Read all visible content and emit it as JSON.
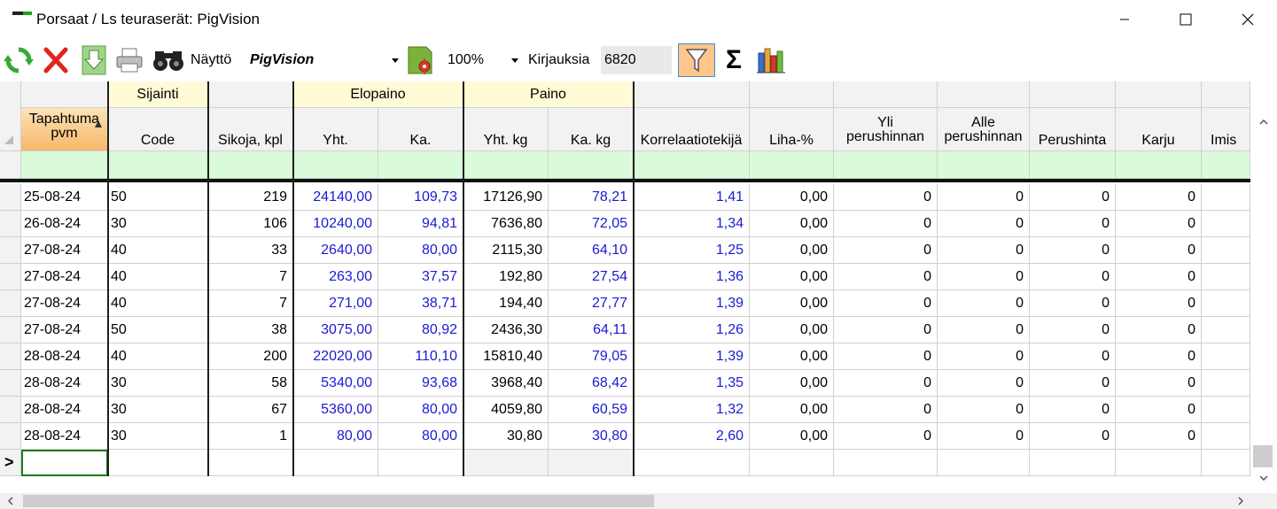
{
  "window": {
    "title": "Porsaat / Ls teuraserät: PigVision"
  },
  "toolbar": {
    "display_label": "Näyttö",
    "display_value": "PigVision",
    "zoom_value": "100%",
    "records_label": "Kirjauksia",
    "records_count": "6820",
    "sum_symbol": "Σ"
  },
  "grid": {
    "groups": {
      "sijainti": "Sijainti",
      "elopaino": "Elopaino",
      "paino": "Paino"
    },
    "columns": {
      "date": [
        "Tapahtuma",
        "pvm"
      ],
      "code": "Code",
      "sikoja": "Sikoja, kpl",
      "elo_yht": "Yht.",
      "elo_ka": "Ka.",
      "paino_yht": "Yht. kg",
      "paino_ka": "Ka. kg",
      "korr": "Korrelaatiotekijä",
      "liha": "Liha-%",
      "yli": [
        "Yli",
        "perushinnan"
      ],
      "alle": [
        "Alle",
        "perushinnan"
      ],
      "perushinta": "Perushinta",
      "karju": "Karju",
      "imis": "Imis"
    },
    "rows": [
      [
        "25-08-24",
        "50",
        "219",
        "24140,00",
        "109,73",
        "17126,90",
        "78,21",
        "1,41",
        "0,00",
        "0",
        "0",
        "0",
        "0"
      ],
      [
        "26-08-24",
        "30",
        "106",
        "10240,00",
        "94,81",
        "7636,80",
        "72,05",
        "1,34",
        "0,00",
        "0",
        "0",
        "0",
        "0"
      ],
      [
        "27-08-24",
        "40",
        "33",
        "2640,00",
        "80,00",
        "2115,30",
        "64,10",
        "1,25",
        "0,00",
        "0",
        "0",
        "0",
        "0"
      ],
      [
        "27-08-24",
        "40",
        "7",
        "263,00",
        "37,57",
        "192,80",
        "27,54",
        "1,36",
        "0,00",
        "0",
        "0",
        "0",
        "0"
      ],
      [
        "27-08-24",
        "40",
        "7",
        "271,00",
        "38,71",
        "194,40",
        "27,77",
        "1,39",
        "0,00",
        "0",
        "0",
        "0",
        "0"
      ],
      [
        "27-08-24",
        "50",
        "38",
        "3075,00",
        "80,92",
        "2436,30",
        "64,11",
        "1,26",
        "0,00",
        "0",
        "0",
        "0",
        "0"
      ],
      [
        "28-08-24",
        "40",
        "200",
        "22020,00",
        "110,10",
        "15810,40",
        "79,05",
        "1,39",
        "0,00",
        "0",
        "0",
        "0",
        "0"
      ],
      [
        "28-08-24",
        "30",
        "58",
        "5340,00",
        "93,68",
        "3968,40",
        "68,42",
        "1,35",
        "0,00",
        "0",
        "0",
        "0",
        "0"
      ],
      [
        "28-08-24",
        "30",
        "67",
        "5360,00",
        "80,00",
        "4059,80",
        "60,59",
        "1,32",
        "0,00",
        "0",
        "0",
        "0",
        "0"
      ],
      [
        "28-08-24",
        "30",
        "1",
        "80,00",
        "80,00",
        "30,80",
        "30,80",
        "2,60",
        "0,00",
        "0",
        "0",
        "0",
        "0"
      ]
    ],
    "new_row_marker": ">"
  },
  "colors": {
    "blue_value": "#1a1ad6",
    "filter_row": "#d9fbd9",
    "group_header": "#fffbd6",
    "sorted_column": "#f6b769",
    "filter_active": "#ffc58a"
  },
  "icons": {
    "refresh": "refresh-icon",
    "delete": "delete-icon",
    "export": "download-icon",
    "print": "printer-icon",
    "find": "binoculars-icon",
    "settings": "document-gear-icon",
    "filter": "filter-icon",
    "sum": "sigma-icon",
    "chart": "bar-chart-icon"
  }
}
